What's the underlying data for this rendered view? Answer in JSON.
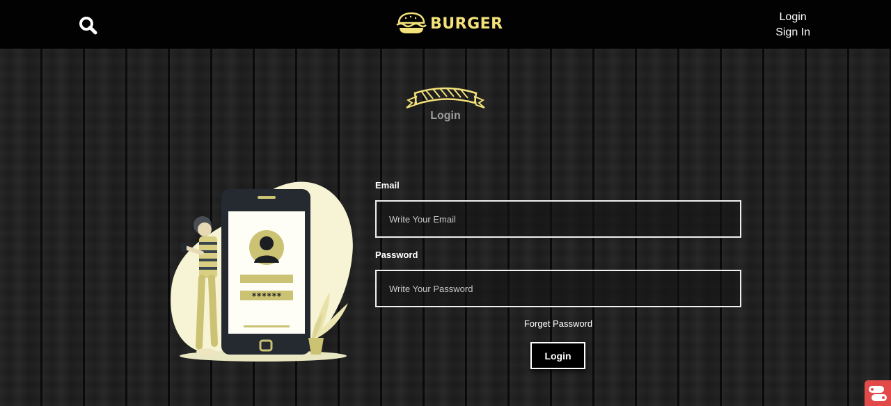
{
  "header": {
    "brand": "BURGER",
    "auth_links": [
      "Login",
      "Sign In"
    ],
    "icons": {
      "search": "search-icon",
      "logo": "burger-logo-icon"
    },
    "brand_color": "#f3e27a"
  },
  "section": {
    "title": "Login",
    "ribbon_icon": "ribbon-banner-icon"
  },
  "form": {
    "email_label": "Email",
    "email_placeholder": "Write Your Email",
    "password_label": "Password",
    "password_placeholder": "Write Your Password",
    "forget_password": "Forget Password",
    "submit_label": "Login",
    "illustration_mask": "******"
  },
  "colors": {
    "header_bg": "#020202",
    "accent": "#f3e27a",
    "illustration_accent": "#cbc274",
    "widget": "#e24a4a"
  }
}
